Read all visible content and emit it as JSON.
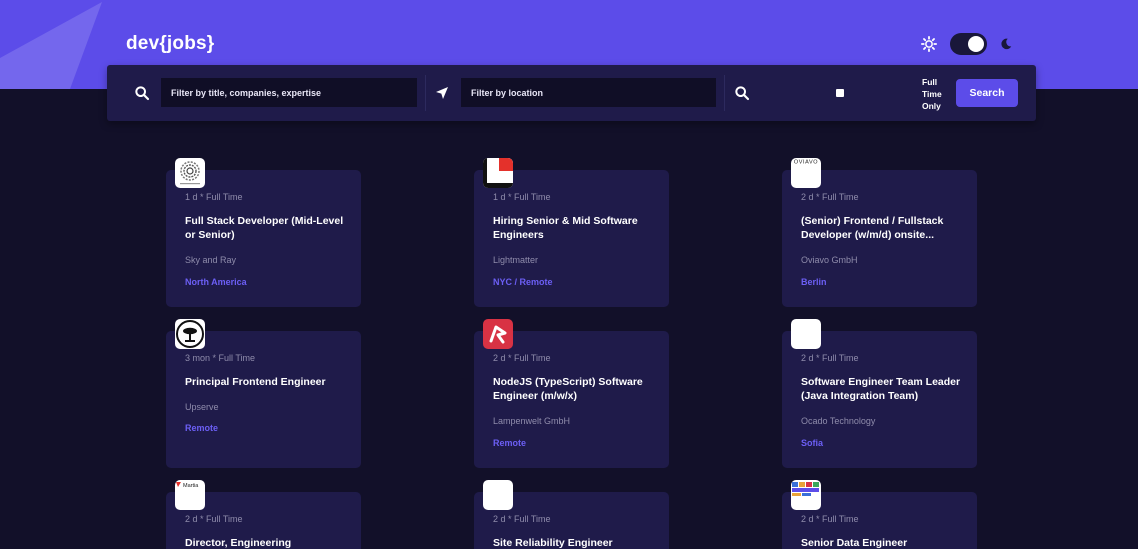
{
  "app": {
    "logo_text": "dev{jobs}"
  },
  "colors": {
    "accent": "#5c4ce9",
    "background": "#121029",
    "card": "#1f1b4a",
    "location": "#6c5ff5"
  },
  "filters": {
    "title_placeholder": "Filter by title, companies, expertise",
    "location_placeholder": "Filter by location",
    "full_time_label_1": "Full",
    "full_time_label_2": "Time",
    "full_time_label_3": "Only",
    "full_time_checked": false,
    "search_label": "Search"
  },
  "theme": {
    "dark_mode": true
  },
  "jobs": [
    {
      "meta": "1 d * Full Time",
      "title": "Full Stack Developer (Mid-Level or Senior)",
      "company": "Sky and Ray",
      "location": "North America",
      "logo": "spiral-logo"
    },
    {
      "meta": "1 d * Full Time",
      "title": "Hiring Senior & Mid Software Engineers",
      "company": "Lightmatter",
      "location": "NYC / Remote",
      "logo": "red-square-logo"
    },
    {
      "meta": "2 d * Full Time",
      "title": "(Senior) Frontend / Fullstack Developer (w/m/d) onsite...",
      "company": "Oviavo GmbH",
      "location": "Berlin",
      "logo": "oviavo-logo",
      "logo_text": "OVIAVO"
    },
    {
      "meta": "3 mon * Full Time",
      "title": "Principal Frontend Engineer",
      "company": "Upserve",
      "location": "Remote",
      "logo": "upserve-logo"
    },
    {
      "meta": "2 d * Full Time",
      "title": "NodeJS (TypeScript) Software Engineer (m/w/x)",
      "company": "Lampenwelt GmbH",
      "location": "Remote",
      "logo": "lampenwelt-logo"
    },
    {
      "meta": "2 d * Full Time",
      "title": "Software Engineer Team Leader (Java Integration Team)",
      "company": "Ocado Technology",
      "location": "Sofia",
      "logo": "blank-logo"
    },
    {
      "meta": "2 d * Full Time",
      "title": "Director, Engineering",
      "company": "",
      "location": "",
      "logo": "martian-logo",
      "logo_text": "Martia"
    },
    {
      "meta": "2 d * Full Time",
      "title": "Site Reliability Engineer",
      "company": "",
      "location": "",
      "logo": "blank-logo"
    },
    {
      "meta": "2 d * Full Time",
      "title": "Senior Data Engineer",
      "company": "",
      "location": "",
      "logo": "colorful-logo"
    }
  ]
}
